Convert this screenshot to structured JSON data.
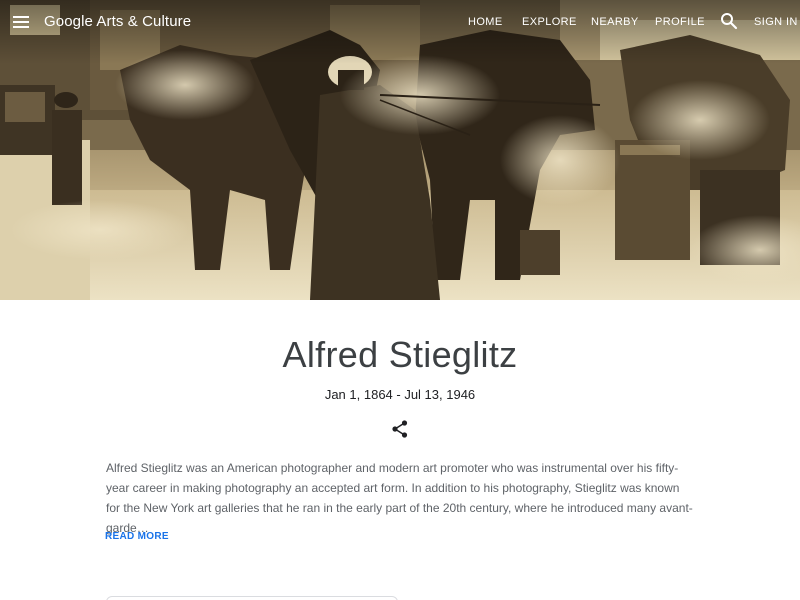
{
  "header": {
    "logo_text": "Google Arts & Culture",
    "nav": {
      "home": "HOME",
      "explore": "EXPLORE",
      "nearby": "NEARBY",
      "profile": "PROFILE",
      "sign_in": "SIGN IN"
    },
    "icons": {
      "menu": "menu-icon",
      "search": "search-icon"
    }
  },
  "hero": {
    "image": "sepia-photograph-horse-drawn-carriage-snow"
  },
  "artist": {
    "name": "Alfred Stieglitz",
    "dates": "Jan 1, 1864 - Jul 13, 1946",
    "share_icon": "share-icon",
    "description": "Alfred Stieglitz was an American photographer and modern art promoter who was instrumental over his fifty-year career in making photography an accepted art form. In addition to his photography, Stieglitz was known for the New York art galleries that he ran in the early part of the 20th century, where he introduced many avant-garde…",
    "read_more": "READ MORE"
  },
  "colors": {
    "title": "#3c4043",
    "body_text": "#5f6368",
    "link": "#1a73e8",
    "sepia_dark": "#4a3d29",
    "sepia_light": "#e6dab8"
  }
}
